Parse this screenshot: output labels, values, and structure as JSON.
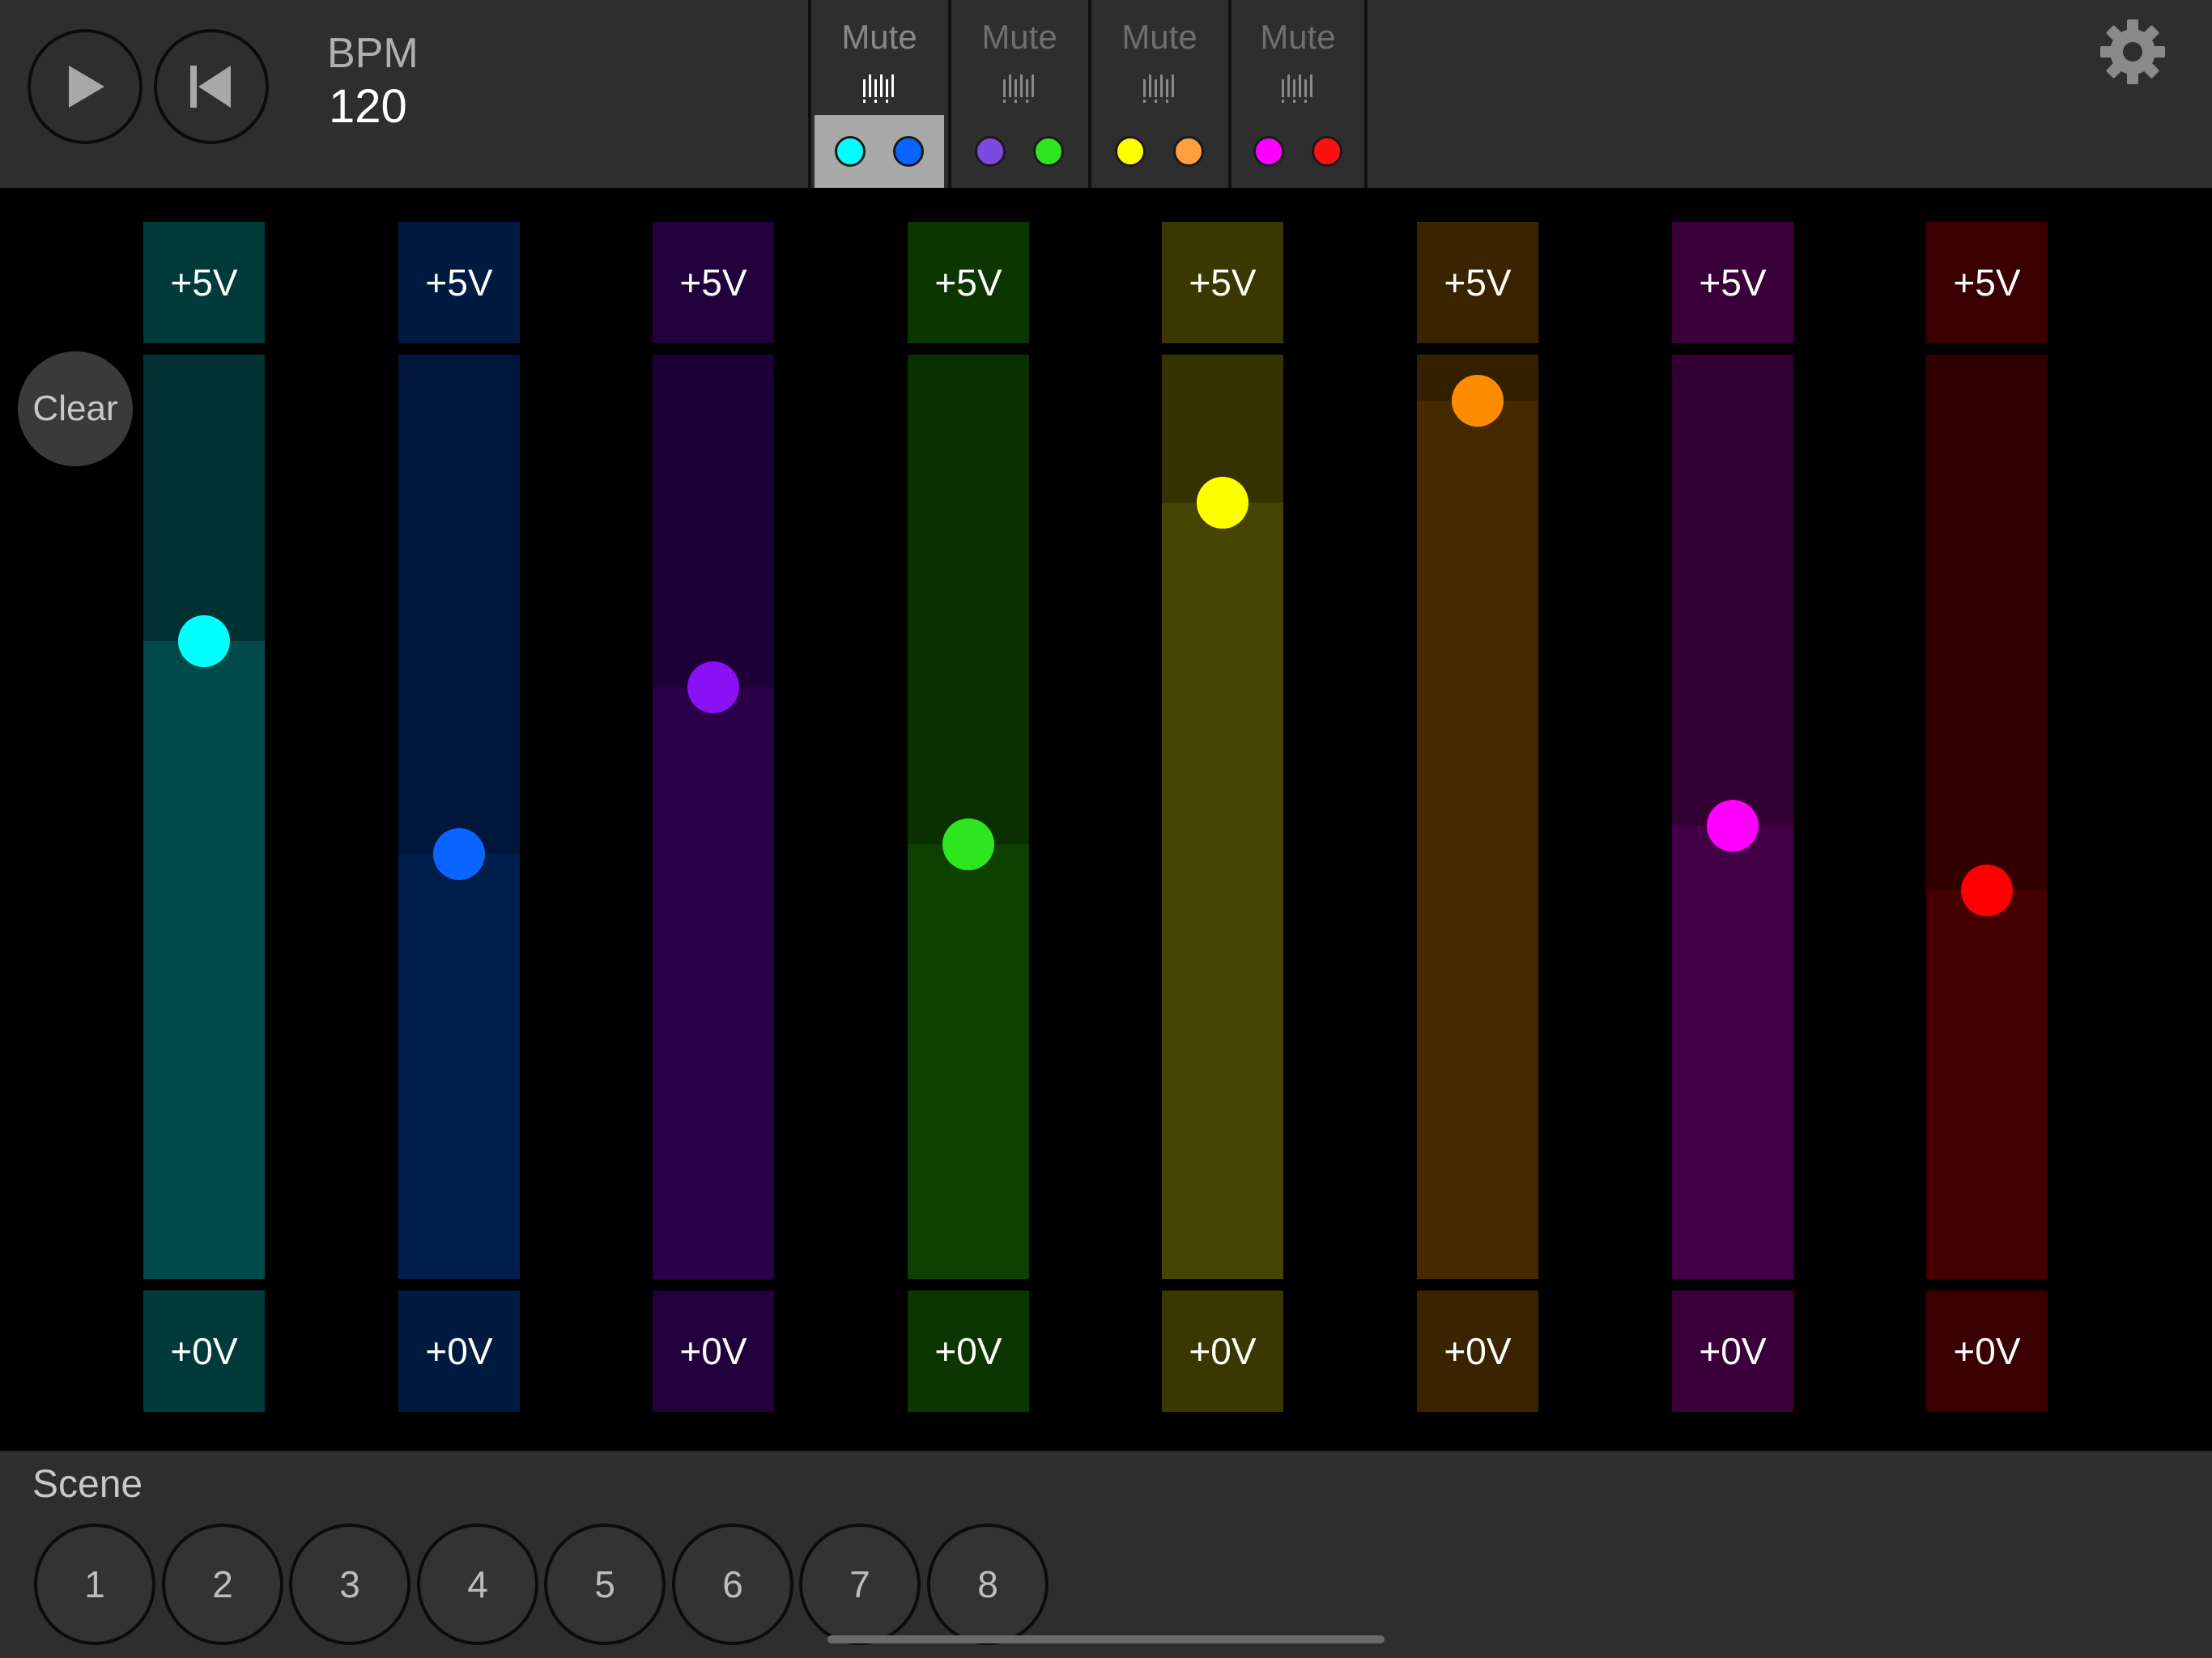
{
  "transport": {
    "play_icon": "play-icon",
    "rewind_icon": "skip-to-start-icon",
    "bpm_label": "BPM",
    "bpm_value": "120"
  },
  "tracks": [
    {
      "mute_label": "Mute",
      "icon": "sequencer-icon",
      "active": true,
      "colors": [
        "#00ffff",
        "#0a64ff"
      ]
    },
    {
      "mute_label": "Mute",
      "icon": "sequencer-icon",
      "active": false,
      "colors": [
        "#7b4ae0",
        "#2ee61f"
      ]
    },
    {
      "mute_label": "Mute",
      "icon": "sequencer-icon",
      "active": false,
      "colors": [
        "#ffff00",
        "#ffa040"
      ]
    },
    {
      "mute_label": "Mute",
      "icon": "sequencer-icon",
      "active": false,
      "colors": [
        "#ff00ff",
        "#ff1010"
      ]
    }
  ],
  "settings_icon": "gear-icon",
  "clear_label": "Clear",
  "channels": [
    {
      "top_label": "+5V",
      "bottom_label": "+0V",
      "level": 0.69,
      "knob": "#00ffff",
      "fill": "#004a4a",
      "bg": "#003232",
      "box": "#013a3a"
    },
    {
      "top_label": "+5V",
      "bottom_label": "+0V",
      "level": 0.46,
      "knob": "#0a64ff",
      "fill": "#001e4c",
      "bg": "#00163a",
      "box": "#001a40"
    },
    {
      "top_label": "+5V",
      "bottom_label": "+0V",
      "level": 0.64,
      "knob": "#8a10f5",
      "fill": "#2a0048",
      "bg": "#1e0036",
      "box": "#22003c"
    },
    {
      "top_label": "+5V",
      "bottom_label": "+0V",
      "level": 0.47,
      "knob": "#2ee61f",
      "fill": "#0e4000",
      "bg": "#0a3000",
      "box": "#0c3600"
    },
    {
      "top_label": "+5V",
      "bottom_label": "+0V",
      "level": 0.84,
      "knob": "#ffff00",
      "fill": "#454400",
      "bg": "#343300",
      "box": "#3a3800"
    },
    {
      "top_label": "+5V",
      "bottom_label": "+0V",
      "level": 0.95,
      "knob": "#ff8c00",
      "fill": "#452a00",
      "bg": "#342000",
      "box": "#3a2400"
    },
    {
      "top_label": "+5V",
      "bottom_label": "+0V",
      "level": 0.49,
      "knob": "#ff00ff",
      "fill": "#440046",
      "bg": "#330034",
      "box": "#3a003a"
    },
    {
      "top_label": "+5V",
      "bottom_label": "+0V",
      "level": 0.42,
      "knob": "#ff0000",
      "fill": "#440000",
      "bg": "#330000",
      "box": "#3a0000"
    }
  ],
  "scene": {
    "label": "Scene",
    "buttons": [
      "1",
      "2",
      "3",
      "4",
      "5",
      "6",
      "7",
      "8"
    ]
  }
}
